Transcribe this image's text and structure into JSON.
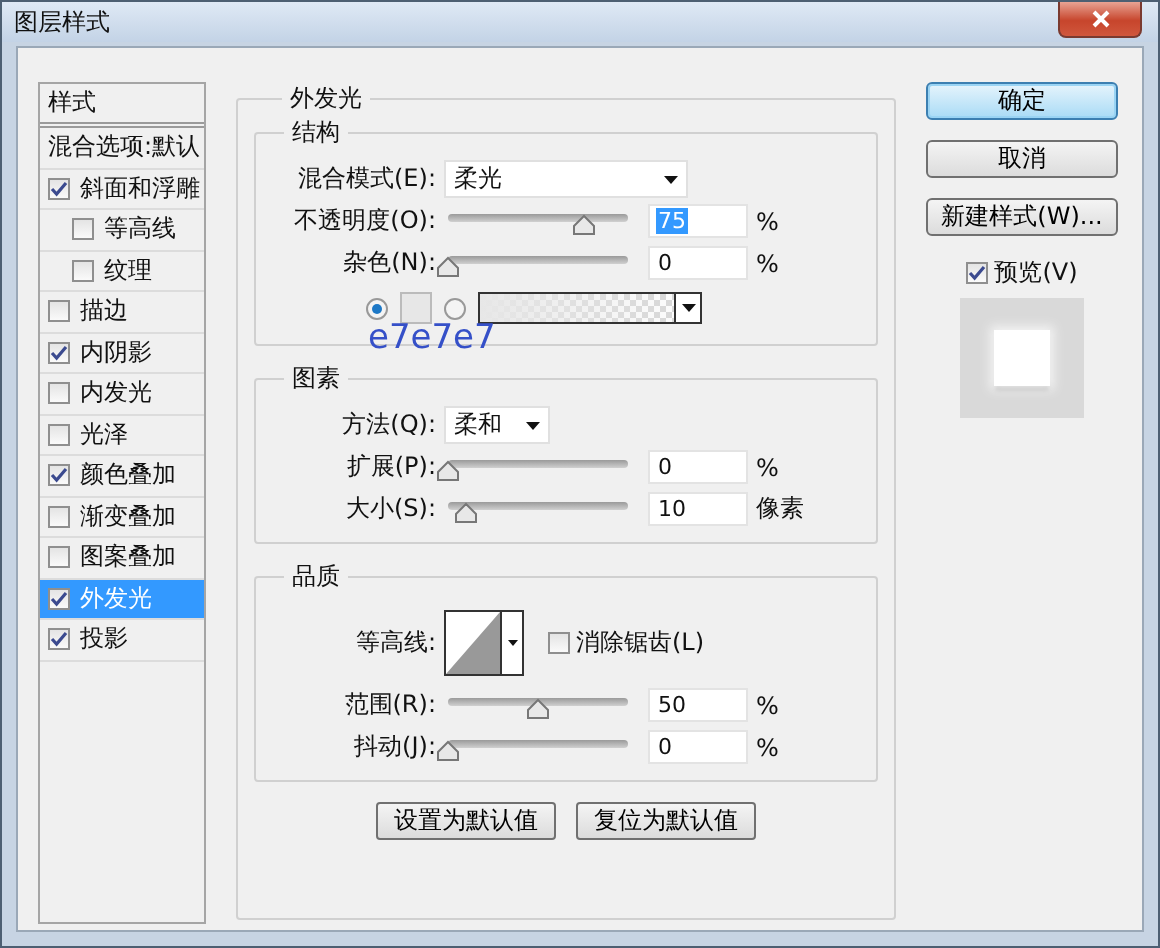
{
  "window": {
    "title": "图层样式"
  },
  "sidebar": {
    "header": "样式",
    "items": [
      {
        "label": "混合选项:默认",
        "kind": "plain",
        "selected": false
      },
      {
        "label": "斜面和浮雕",
        "kind": "check",
        "checked": true,
        "selected": false,
        "children": [
          {
            "label": "等高线",
            "kind": "check",
            "checked": false,
            "selected": false
          },
          {
            "label": "纹理",
            "kind": "check",
            "checked": false,
            "selected": false
          }
        ]
      },
      {
        "label": "描边",
        "kind": "check",
        "checked": false,
        "selected": false
      },
      {
        "label": "内阴影",
        "kind": "check",
        "checked": true,
        "selected": false
      },
      {
        "label": "内发光",
        "kind": "check",
        "checked": false,
        "selected": false
      },
      {
        "label": "光泽",
        "kind": "check",
        "checked": false,
        "selected": false
      },
      {
        "label": "颜色叠加",
        "kind": "check",
        "checked": true,
        "selected": false
      },
      {
        "label": "渐变叠加",
        "kind": "check",
        "checked": false,
        "selected": false
      },
      {
        "label": "图案叠加",
        "kind": "check",
        "checked": false,
        "selected": false
      },
      {
        "label": "外发光",
        "kind": "check",
        "checked": true,
        "selected": true
      },
      {
        "label": "投影",
        "kind": "check",
        "checked": true,
        "selected": false
      }
    ]
  },
  "panel": {
    "title": "外发光",
    "groups": [
      {
        "title": "结构",
        "rows": [
          {
            "kind": "dropdown",
            "label": "混合模式(E):",
            "value": "柔光"
          },
          {
            "kind": "slider",
            "label": "不透明度(O):",
            "level": 0.75,
            "value": "75",
            "value_highlighted": true,
            "unit": "%"
          },
          {
            "kind": "slider",
            "label": "杂色(N):",
            "level": 0,
            "value": "0",
            "value_highlighted": false,
            "unit": "%"
          },
          {
            "kind": "source",
            "options": [
              {
                "kind": "swatch",
                "selected": true
              },
              {
                "kind": "gradient",
                "selected": false
              }
            ]
          }
        ]
      },
      {
        "title": "图素",
        "rows": [
          {
            "kind": "dropdown",
            "label": "方法(Q):",
            "value": "柔和"
          },
          {
            "kind": "slider",
            "label": "扩展(P):",
            "level": 0,
            "value": "0",
            "value_highlighted": false,
            "unit": "%"
          },
          {
            "kind": "slider",
            "label": "大小(S):",
            "level": 0.1,
            "value": "10",
            "value_highlighted": false,
            "unit": "像素"
          }
        ]
      },
      {
        "title": "品质",
        "rows": [
          {
            "kind": "contour",
            "label": "等高线:",
            "option": {
              "label": "消除锯齿(L)",
              "checked": false
            }
          },
          {
            "kind": "slider",
            "label": "范围(R):",
            "level": 0.5,
            "value": "50",
            "value_highlighted": false,
            "unit": "%"
          },
          {
            "kind": "slider",
            "label": "抖动(J):",
            "level": 0,
            "value": "0",
            "value_highlighted": false,
            "unit": "%"
          }
        ]
      }
    ],
    "buttons": [
      "设置为默认值",
      "复位为默认值"
    ]
  },
  "annotation": "e7e7e7",
  "actions": {
    "buttons": [
      {
        "label": "确定",
        "default": true
      },
      {
        "label": "取消",
        "default": false
      },
      {
        "label": "新建样式(W)...",
        "default": false
      }
    ],
    "preview": {
      "label": "预览(V)",
      "checked": true
    }
  }
}
